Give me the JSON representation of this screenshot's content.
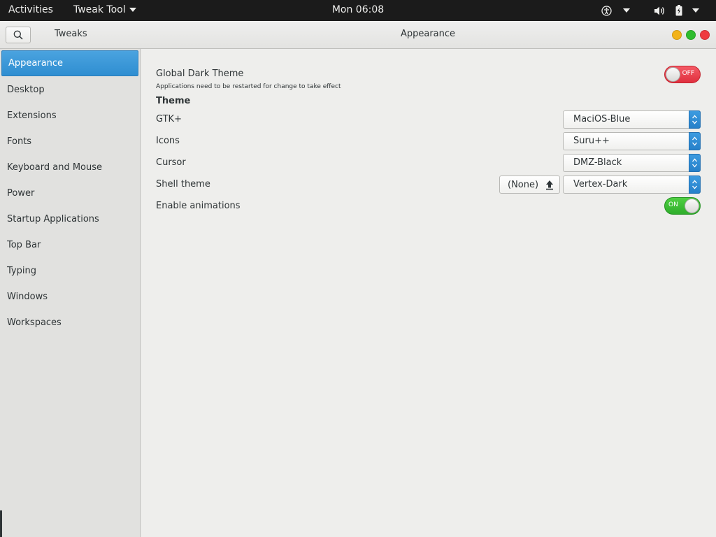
{
  "topbar": {
    "activities": "Activities",
    "app_menu": "Tweak Tool",
    "clock": "Mon 06:08",
    "tray_icons": [
      "accessibility-icon",
      "chevron-down-icon",
      "volume-icon",
      "battery-icon",
      "chevron-down-icon"
    ]
  },
  "headerbar": {
    "sidebar_title": "Tweaks",
    "main_title": "Appearance",
    "window_buttons": [
      {
        "name": "minimize",
        "color": "#f3b319"
      },
      {
        "name": "maximize",
        "color": "#2ebd2e"
      },
      {
        "name": "close",
        "color": "#ef3b3f"
      }
    ]
  },
  "sidebar": {
    "items": [
      {
        "label": "Appearance",
        "active": true
      },
      {
        "label": "Desktop"
      },
      {
        "label": "Extensions"
      },
      {
        "label": "Fonts"
      },
      {
        "label": "Keyboard and Mouse"
      },
      {
        "label": "Power"
      },
      {
        "label": "Startup Applications"
      },
      {
        "label": "Top Bar"
      },
      {
        "label": "Typing"
      },
      {
        "label": "Windows"
      },
      {
        "label": "Workspaces"
      }
    ]
  },
  "content": {
    "dark_theme": {
      "label": "Global Dark Theme",
      "subtext": "Applications need to be restarted for change to take effect",
      "state": "OFF"
    },
    "theme_section": "Theme",
    "gtk": {
      "label": "GTK+",
      "value": "MaciOS-Blue"
    },
    "icons": {
      "label": "Icons",
      "value": "Suru++"
    },
    "cursor": {
      "label": "Cursor",
      "value": "DMZ-Black"
    },
    "shell": {
      "label": "Shell theme",
      "file_value": "(None)",
      "value": "Vertex-Dark"
    },
    "animations": {
      "label": "Enable animations",
      "state": "ON"
    }
  },
  "colors": {
    "accent": "#3196d8",
    "switch_off": "#e83643",
    "switch_on": "#3cbf35",
    "topbar": "#1b1b1b"
  }
}
